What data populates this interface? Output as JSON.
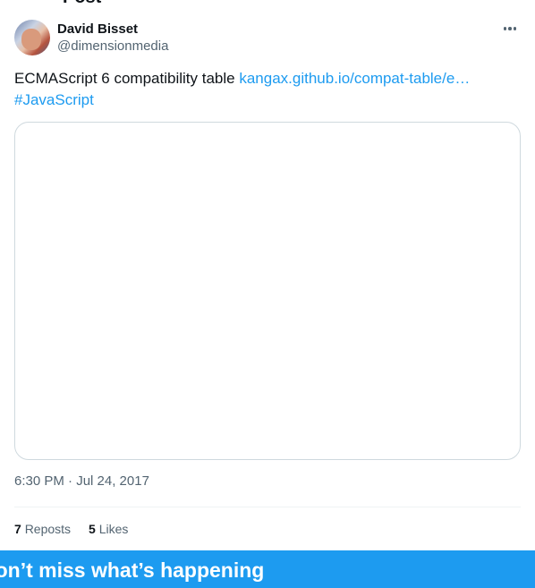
{
  "header": {
    "title": "Post"
  },
  "author": {
    "name": "David Bisset",
    "handle": "@dimensionmedia"
  },
  "more_icon": "more-horizontal-icon",
  "tweet": {
    "text": "ECMAScript 6 compatibility table",
    "link_text": "kangax.github.io/compat-table/e…",
    "hashtag": "#JavaScript"
  },
  "meta": {
    "timestamp": "6:30 PM · Jul 24, 2017"
  },
  "stats": {
    "reposts_count": "7",
    "reposts_label": "Reposts",
    "likes_count": "5",
    "likes_label": "Likes"
  },
  "banner": {
    "title": "Don’t miss what’s happening"
  },
  "colors": {
    "accent": "#1d9bf0",
    "text_primary": "#0f1419",
    "text_secondary": "#536471",
    "border": "#cfd9de"
  }
}
